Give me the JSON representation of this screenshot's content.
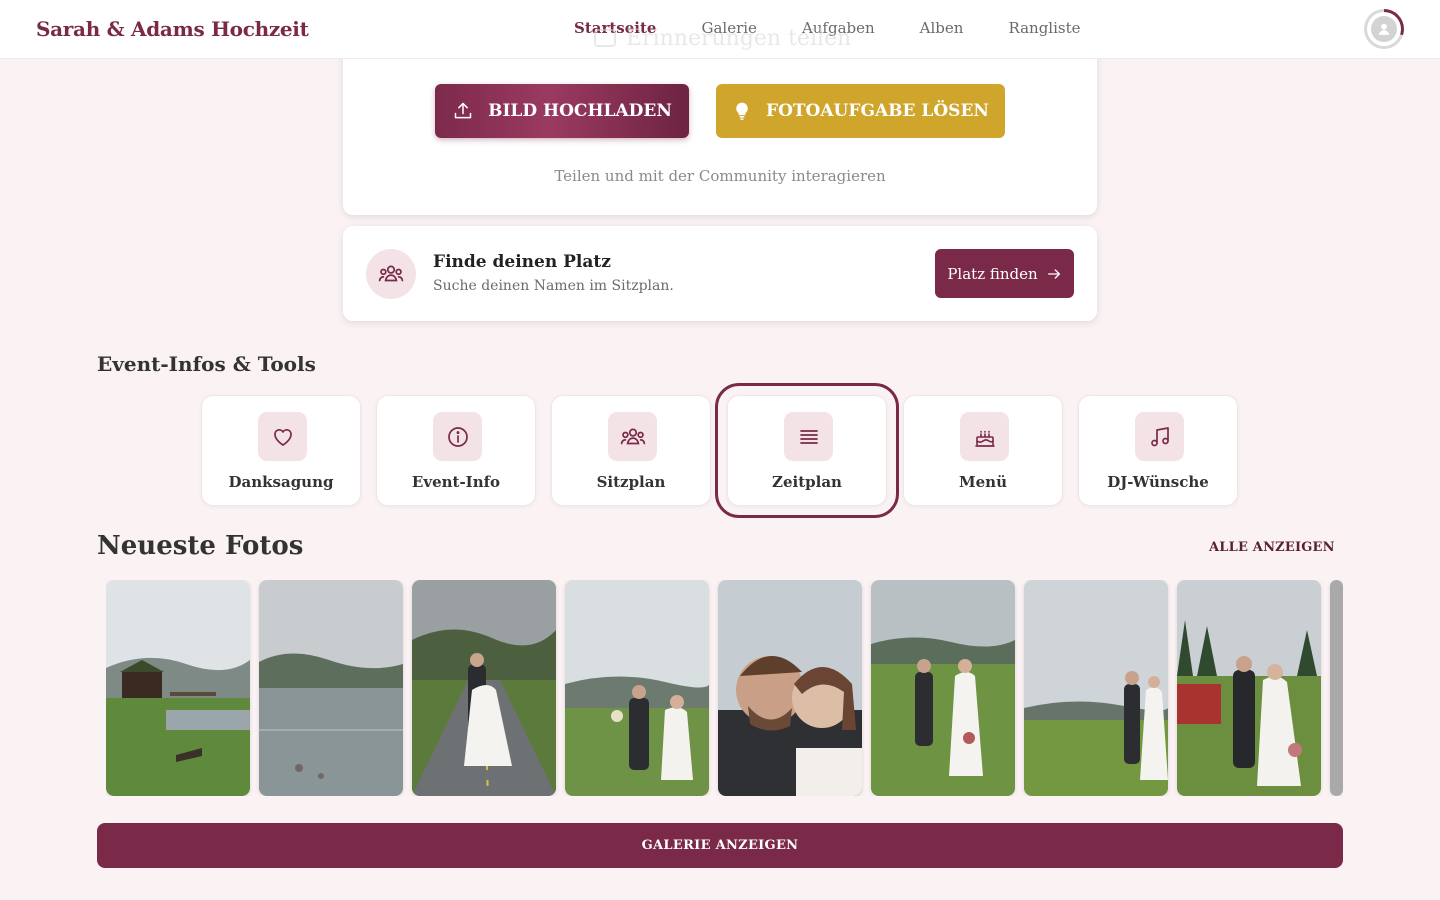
{
  "header": {
    "brand": "Sarah & Adams Hochzeit",
    "nav": [
      "Startseite",
      "Galerie",
      "Aufgaben",
      "Alben",
      "Rangliste"
    ],
    "active_nav": "Startseite",
    "ghost_title": "Erinnerungen teilen",
    "avatar_icon": "user-icon"
  },
  "upload": {
    "upload_label": "BILD HOCHLADEN",
    "task_label": "FOTOAUFGABE LÖSEN",
    "subtitle": "Teilen und mit der Community interagieren"
  },
  "seat": {
    "title": "Finde deinen Platz",
    "subtitle": "Suche deinen Namen im Sitzplan.",
    "button": "Platz finden"
  },
  "tools": {
    "title": "Event-Infos & Tools",
    "items": [
      {
        "label": "Danksagung",
        "icon": "heart-icon"
      },
      {
        "label": "Event-Info",
        "icon": "info-icon"
      },
      {
        "label": "Sitzplan",
        "icon": "people-icon"
      },
      {
        "label": "Zeitplan",
        "icon": "list-icon"
      },
      {
        "label": "Menü",
        "icon": "cake-icon"
      },
      {
        "label": "DJ-Wünsche",
        "icon": "music-icon"
      }
    ],
    "focused": "Zeitplan"
  },
  "photos": {
    "title": "Neueste Fotos",
    "show_all": "ALLE ANZEIGEN",
    "gallery_button": "GALERIE ANZEIGEN"
  },
  "colors": {
    "brand": "#7a2a48",
    "gold": "#cfa52c",
    "background": "#fbf3f3",
    "icon_tile": "#f3e3e6"
  }
}
